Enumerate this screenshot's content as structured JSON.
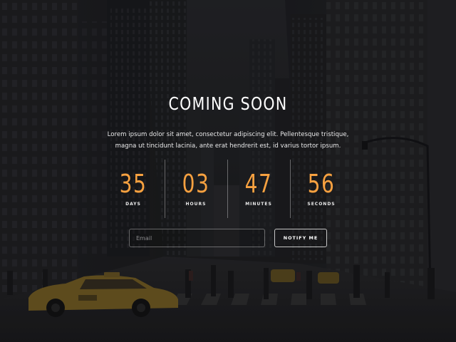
{
  "hero": {
    "title": "COMING SOON",
    "lead": "Lorem ipsum dolor sit amet, consectetur adipiscing elit. Pellentesque tristique, magna ut tincidunt lacinia, ante erat hendrerit est, id varius tortor ipsum."
  },
  "countdown": {
    "accent_color": "#f7a140",
    "items": [
      {
        "value": "35",
        "label": "DAYS"
      },
      {
        "value": "03",
        "label": "HOURS"
      },
      {
        "value": "47",
        "label": "MINUTES"
      },
      {
        "value": "56",
        "label": "SECONDS"
      }
    ]
  },
  "subscribe": {
    "email_placeholder": "Email",
    "button_label": "NOTIFY ME"
  },
  "background": {
    "description_icon": "city-street-photo",
    "taxi_sign": "TAXI"
  }
}
